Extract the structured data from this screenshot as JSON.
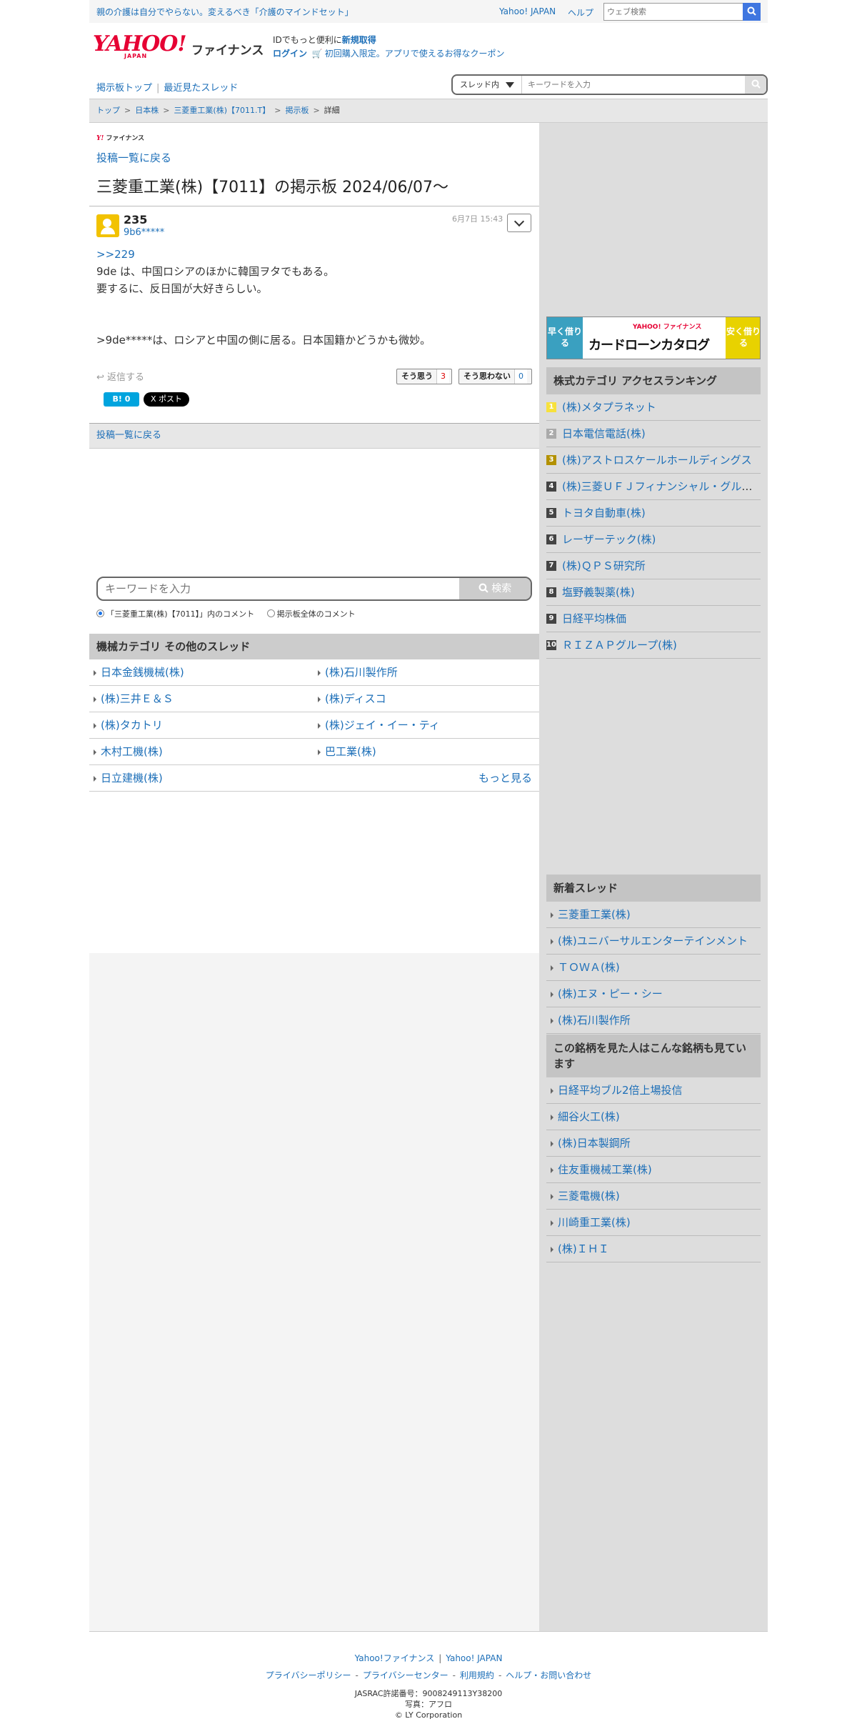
{
  "topbar": {
    "promo": "親の介護は自分でやらない。変えるべき「介護のマインドセット」",
    "yahoo_japan": "Yahoo! JAPAN",
    "help": "ヘルプ",
    "web_search_placeholder": "ウェブ検索"
  },
  "header": {
    "logo_text": "YAHOO!",
    "logo_sub": "JAPAN",
    "finance": "ファイナンス",
    "id_text": "IDでもっと便利に",
    "signup": "新規取得",
    "login": "ログイン",
    "coupon": "初回購入限定。アプリで使えるお得なクーポン"
  },
  "subnav": {
    "board_top": "掲示板トップ",
    "recent": "最近見たスレッド",
    "scope": "スレッド内",
    "keyword_placeholder": "キーワードを入力"
  },
  "breadcrumb": [
    "トップ",
    "日本株",
    "三菱重工業(株)【7011.T】",
    "掲示板",
    "詳細"
  ],
  "post_page": {
    "mini_logo": "ファイナンス",
    "back_to_list": "投稿一覧に戻る",
    "title": "三菱重工業(株)【7011】の掲示板 2024/06/07〜",
    "post_number": "235",
    "user": "9b6*****",
    "date": "6月7日 15:43",
    "reply_link": ">>229",
    "body_lines": [
      "9de は、中国ロシアのほかに韓国ヲタでもある。",
      "要するに、反日国が大好きらしい。",
      "",
      "",
      ">9de*****は、ロシアと中国の側に居る。日本国籍かどうかも微妙。"
    ],
    "reply_action": "返信する",
    "agree_label": "そう思う",
    "agree_count": "3",
    "disagree_label": "そう思わない",
    "disagree_count": "0",
    "hatena": "B! 0",
    "x_post": "X ポスト",
    "back_bar": "投稿一覧に戻る"
  },
  "keyword_search": {
    "placeholder": "キーワードを入力",
    "button": "検索",
    "option_thread": "「三菱重工業(株)【7011】」内のコメント",
    "option_all": "掲示板全体のコメント"
  },
  "category_threads": {
    "heading": "機械カテゴリ その他のスレッド",
    "rows": [
      [
        "日本金銭機械(株)",
        "(株)石川製作所"
      ],
      [
        "(株)三井Ｅ＆Ｓ",
        "(株)ディスコ"
      ],
      [
        "(株)タカトリ",
        "(株)ジェイ・イー・ティ"
      ],
      [
        "木村工機(株)",
        "巴工業(株)"
      ]
    ],
    "last_row_left": "日立建機(株)",
    "more": "もっと見る"
  },
  "banner": {
    "left": "早く借りる",
    "right": "安く借りる",
    "title": "カードローンカタログ",
    "sub": "YAHOO! ファイナンス"
  },
  "ranking": {
    "heading": "株式カテゴリ アクセスランキング",
    "items": [
      {
        "rank": "1",
        "name": "(株)メタプラネット"
      },
      {
        "rank": "2",
        "name": "日本電信電話(株)"
      },
      {
        "rank": "3",
        "name": "(株)アストロスケールホールディングス"
      },
      {
        "rank": "4",
        "name": "(株)三菱ＵＦＪフィナンシャル・グループ"
      },
      {
        "rank": "5",
        "name": "トヨタ自動車(株)"
      },
      {
        "rank": "6",
        "name": "レーザーテック(株)"
      },
      {
        "rank": "7",
        "name": "(株)ＱＰＳ研究所"
      },
      {
        "rank": "8",
        "name": "塩野義製薬(株)"
      },
      {
        "rank": "9",
        "name": "日経平均株価"
      },
      {
        "rank": "10",
        "name": "ＲＩＺＡＰグループ(株)"
      }
    ]
  },
  "new_threads": {
    "heading": "新着スレッド",
    "items": [
      "三菱重工業(株)",
      "(株)ユニバーサルエンターテインメント",
      "ＴＯＷＡ(株)",
      "(株)エヌ・ピー・シー",
      "(株)石川製作所"
    ]
  },
  "also_viewed": {
    "heading": "この銘柄を見た人はこんな銘柄も見ています",
    "items": [
      "日経平均ブル2倍上場投信",
      "細谷火工(株)",
      "(株)日本製鋼所",
      "住友重機械工業(株)",
      "三菱電機(株)",
      "川崎重工業(株)",
      "(株)ＩＨＩ"
    ]
  },
  "footer": {
    "yf": "Yahoo!ファイナンス",
    "yj": "Yahoo! JAPAN",
    "privacy_policy": "プライバシーポリシー",
    "privacy_center": "プライバシーセンター",
    "terms": "利用規約",
    "help_contact": "ヘルプ・お問い合わせ",
    "jasrac": "JASRAC許諾番号：9008249113Y38200",
    "photo": "写真：アフロ",
    "copyright": "© LY Corporation"
  },
  "colors": {
    "link": "#1d6fb8",
    "brand_red": "#e60033",
    "sidebar_bg": "#dddddd",
    "search_blue": "#3f76e0"
  }
}
